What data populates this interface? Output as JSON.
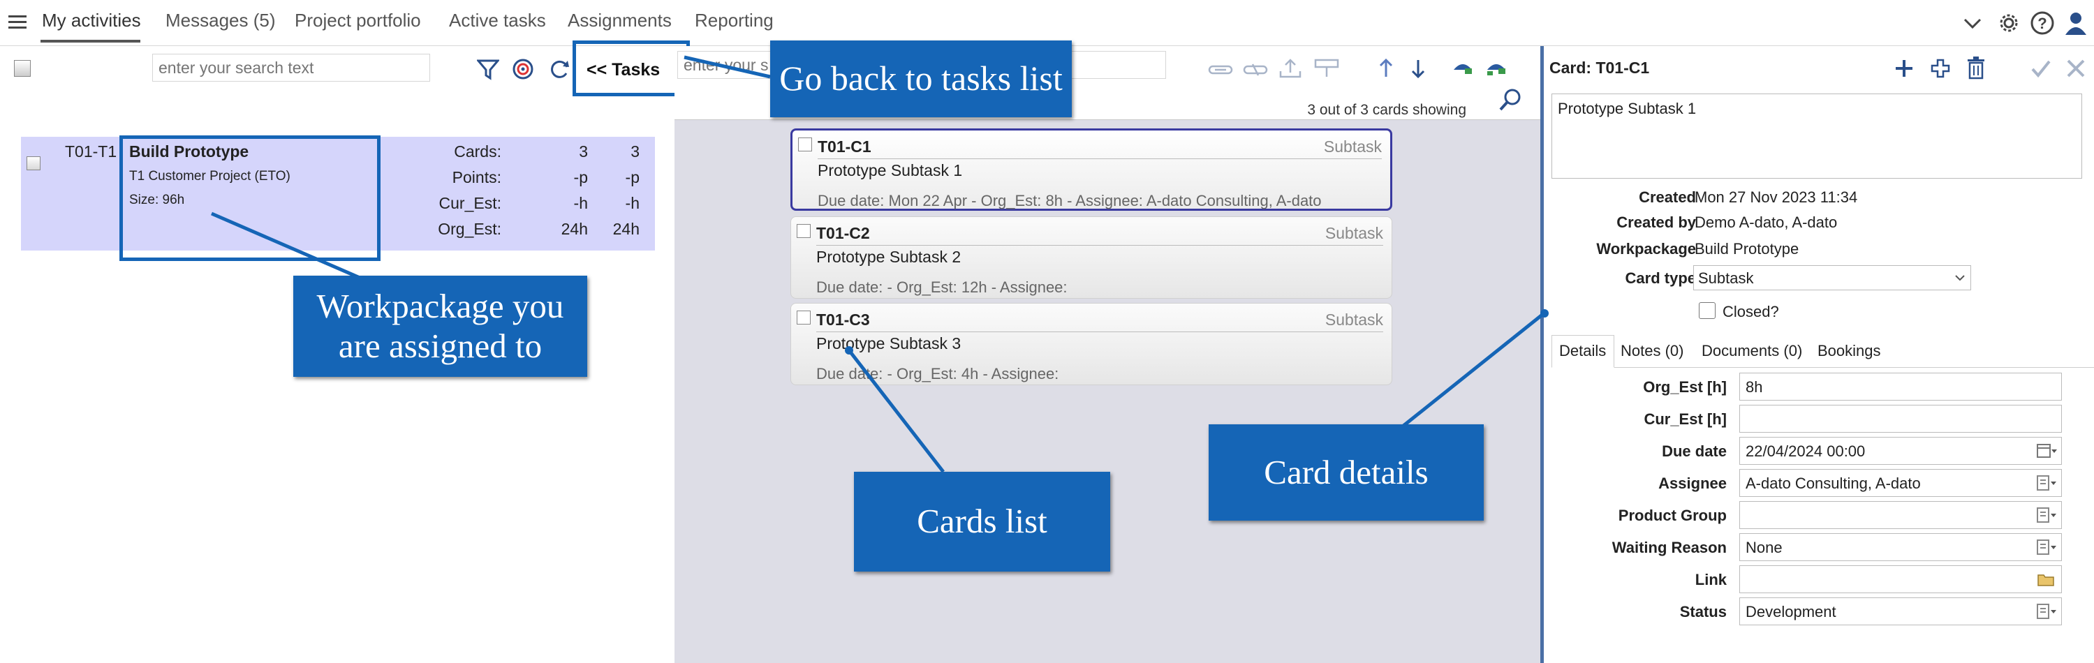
{
  "nav": {
    "tabs": [
      "My activities",
      "Messages (5)",
      "Project portfolio",
      "Active tasks",
      "Assignments",
      "Reporting"
    ],
    "icons": [
      "menu-icon",
      "chevron-down-icon",
      "settings-icon",
      "help-icon",
      "user-icon"
    ]
  },
  "left": {
    "search_placeholder": "enter your search text",
    "tasks_button": "<< Tasks",
    "row": {
      "id": "T01-T1",
      "title": "Build Prototype",
      "project": "T1 Customer Project (ETO)",
      "size": "Size: 96h",
      "stats": [
        {
          "label": "Cards:",
          "v1": "3",
          "v2": "3"
        },
        {
          "label": "Points:",
          "v1": "-p",
          "v2": "-p"
        },
        {
          "label": "Cur_Est:",
          "v1": "-h",
          "v2": "-h"
        },
        {
          "label": "Org_Est:",
          "v1": "24h",
          "v2": "24h"
        }
      ]
    }
  },
  "middle": {
    "search_placeholder": "enter your s",
    "showing": "3 out of 3 cards showing",
    "cards": [
      {
        "id": "T01-C1",
        "type": "Subtask",
        "title": "Prototype Subtask 1",
        "due": "Due date: Mon 22 Apr - Org_Est: 8h - Assignee: A-dato Consulting, A-dato"
      },
      {
        "id": "T01-C2",
        "type": "Subtask",
        "title": "Prototype Subtask 2",
        "due": "Due date:  - Org_Est: 12h - Assignee:"
      },
      {
        "id": "T01-C3",
        "type": "Subtask",
        "title": "Prototype Subtask 3",
        "due": "Due date:  - Org_Est: 4h - Assignee:"
      }
    ]
  },
  "right": {
    "header": "Card: T01-C1",
    "description": "Prototype Subtask 1",
    "created_label": "Created",
    "created": "Mon 27 Nov 2023 11:34",
    "created_by_label": "Created by",
    "created_by": "Demo A-dato, A-dato",
    "workpackage_label": "Workpackage",
    "workpackage": "Build Prototype",
    "card_type_label": "Card type",
    "card_type": "Subtask",
    "closed_label": "Closed?",
    "tabs": [
      "Details",
      "Notes (0)",
      "Documents (0)",
      "Bookings"
    ],
    "fields": [
      {
        "label": "Org_Est [h]",
        "value": "8h"
      },
      {
        "label": "Cur_Est [h]",
        "value": ""
      },
      {
        "label": "Due date",
        "value": "22/04/2024 00:00"
      },
      {
        "label": "Assignee",
        "value": "A-dato Consulting, A-dato"
      },
      {
        "label": "Product Group",
        "value": ""
      },
      {
        "label": "Waiting Reason",
        "value": "None"
      },
      {
        "label": "Link",
        "value": ""
      },
      {
        "label": "Status",
        "value": "Development"
      }
    ]
  },
  "callouts": {
    "tasks": "Go back to tasks list",
    "workpackage": "Workpackage you are assigned to",
    "cards": "Cards list",
    "details": "Card details"
  },
  "colors": {
    "callout": "#1565b6",
    "selection": "#d5d5fb",
    "accent": "#3a56a8"
  }
}
